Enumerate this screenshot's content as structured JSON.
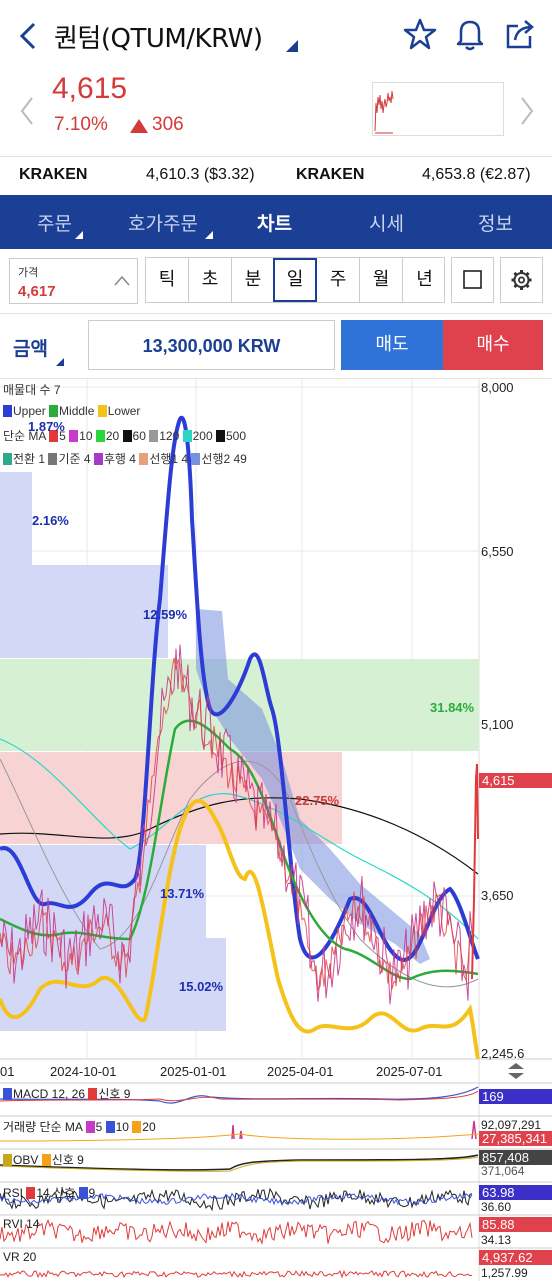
{
  "header": {
    "title": "퀀텀(QTUM/KRW)",
    "icons": [
      "back-icon",
      "star-icon",
      "bell-icon",
      "share-icon"
    ]
  },
  "price": {
    "current": "4,615",
    "change_pct": "7.10%",
    "change_abs": "306",
    "color": "#d33a3a"
  },
  "exchanges": [
    {
      "name": "KRAKEN",
      "value": "4,610.3 ($3.32)"
    },
    {
      "name": "KRAKEN",
      "value": "4,653.8 (€2.87)"
    }
  ],
  "tabs": [
    {
      "label": "주문",
      "has_caret": true
    },
    {
      "label": "호가주문",
      "has_caret": true
    },
    {
      "label": "차트",
      "active": true
    },
    {
      "label": "시세"
    },
    {
      "label": "정보"
    }
  ],
  "price_box": {
    "label": "가격",
    "value": "4,617"
  },
  "periods": [
    "틱",
    "초",
    "분",
    "일",
    "주",
    "월",
    "년"
  ],
  "selected_period": "일",
  "order": {
    "amount_label": "금액",
    "amount_value": "13,300,000 KRW",
    "sell_label": "매도",
    "buy_label": "매수",
    "sell_color": "#2f73d9",
    "buy_color": "#e0424d"
  },
  "chart": {
    "legend": {
      "volume_profile": "매물대 수 7",
      "bollinger": [
        "Upper",
        "Middle",
        "Lower"
      ],
      "ma_label": "단순 MA",
      "ma_periods": [
        "5",
        "10",
        "20",
        "60",
        "120",
        "200",
        "500"
      ],
      "ichimoku": [
        "전환 1",
        "기준 4",
        "후행 4",
        "선행1 4",
        "선행2 49"
      ]
    },
    "y_labels": [
      "8,000",
      "6,550",
      "5,100",
      "3,650",
      "2,245.6"
    ],
    "x_labels": [
      "01",
      "2024-10-01",
      "2025-01-01",
      "2025-04-01",
      "2025-07-01"
    ],
    "volume_profile_pct": [
      "1.87%",
      "2.16%",
      "12.59%",
      "31.84%",
      "22.75%",
      "13.71%",
      "15.02%"
    ],
    "current_tag": "4,615",
    "macd": {
      "label_macd": "MACD 12, 26",
      "label_signal": "신호 9",
      "value": "169"
    },
    "volume": {
      "label": "거래량 단순 MA",
      "periods": [
        "5",
        "10",
        "20"
      ],
      "top_value": "92,097,291",
      "value": "27,385,341"
    },
    "obv": {
      "label": "OBV",
      "signal": "신호 9",
      "value": "857,408",
      "partial_behind": "371,064"
    },
    "rsi": {
      "label": "RSI",
      "period": "14",
      "signal": "신호",
      "signal_period": "9",
      "value": "63.98",
      "lower": "36.60"
    },
    "rvi": {
      "label": "RVI 14",
      "value": "85.88",
      "lower": "34.13"
    },
    "vr": {
      "label": "VR 20",
      "value": "4,937.62",
      "lower": "1,257.99"
    }
  },
  "chart_data": {
    "type": "line",
    "title": "",
    "x": [
      "2024-10-01",
      "2025-01-01",
      "2025-04-01",
      "2025-07-01"
    ],
    "y_ticks": [
      8000,
      6550,
      5100,
      3650,
      2245.6
    ],
    "ylim": [
      2245.6,
      8000
    ],
    "series": [
      {
        "name": "Upper",
        "values": [
          3900,
          4700,
          7300,
          5300,
          4300,
          3600,
          3750,
          3300
        ]
      },
      {
        "name": "Middle",
        "values": [
          3300,
          3450,
          5200,
          4600,
          3400,
          3050,
          3200,
          3050
        ]
      },
      {
        "name": "Lower",
        "values": [
          2700,
          2600,
          3500,
          3900,
          2400,
          2500,
          2450,
          2300
        ]
      }
    ],
    "volume_profile": [
      {
        "range": "top",
        "pct": 1.87
      },
      {
        "range": "upper",
        "pct": 2.16
      },
      {
        "range": "high-mid",
        "pct": 12.59
      },
      {
        "range": "mid-high",
        "pct": 31.84
      },
      {
        "range": "mid",
        "pct": 22.75
      },
      {
        "range": "low-mid",
        "pct": 13.71
      },
      {
        "range": "low",
        "pct": 15.02
      }
    ],
    "last_price": 4615,
    "grid": true
  }
}
